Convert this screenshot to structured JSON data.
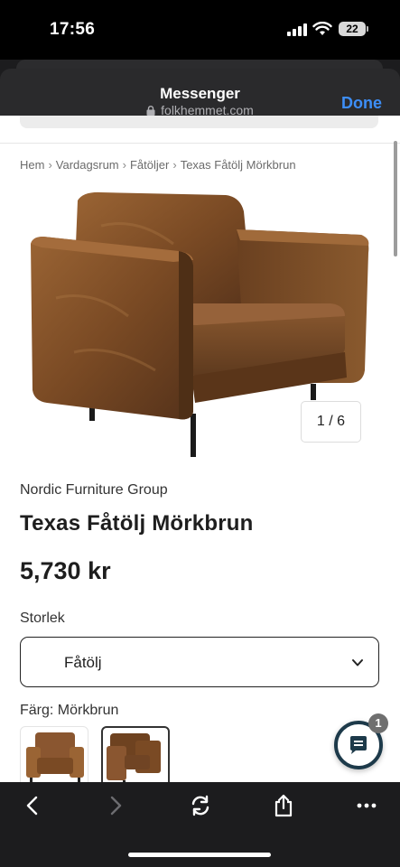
{
  "status_bar": {
    "time": "17:56",
    "battery": "22"
  },
  "webview": {
    "title": "Messenger",
    "url": "folkhemmet.com",
    "done_label": "Done"
  },
  "breadcrumb": [
    "Hem",
    "Vardagsrum",
    "Fåtöljer",
    "Texas Fåtölj Mörkbrun"
  ],
  "product": {
    "image_counter": "1 / 6",
    "brand": "Nordic Furniture Group",
    "title": "Texas Fåtölj Mörkbrun",
    "price": "5,730 kr",
    "size_label": "Storlek",
    "size_value": "Fåtölj",
    "color_label": "Färg: Mörkbrun"
  },
  "chat": {
    "badge": "1",
    "icon": "chat-bubble-icon"
  },
  "toolbar": {
    "icons": [
      "back-icon",
      "forward-icon",
      "reload-icon",
      "share-icon",
      "more-icon"
    ]
  },
  "colors": {
    "leather": "#7a4a24",
    "accent": "#3d8ef7",
    "chat_ring": "#1d3a4a"
  }
}
